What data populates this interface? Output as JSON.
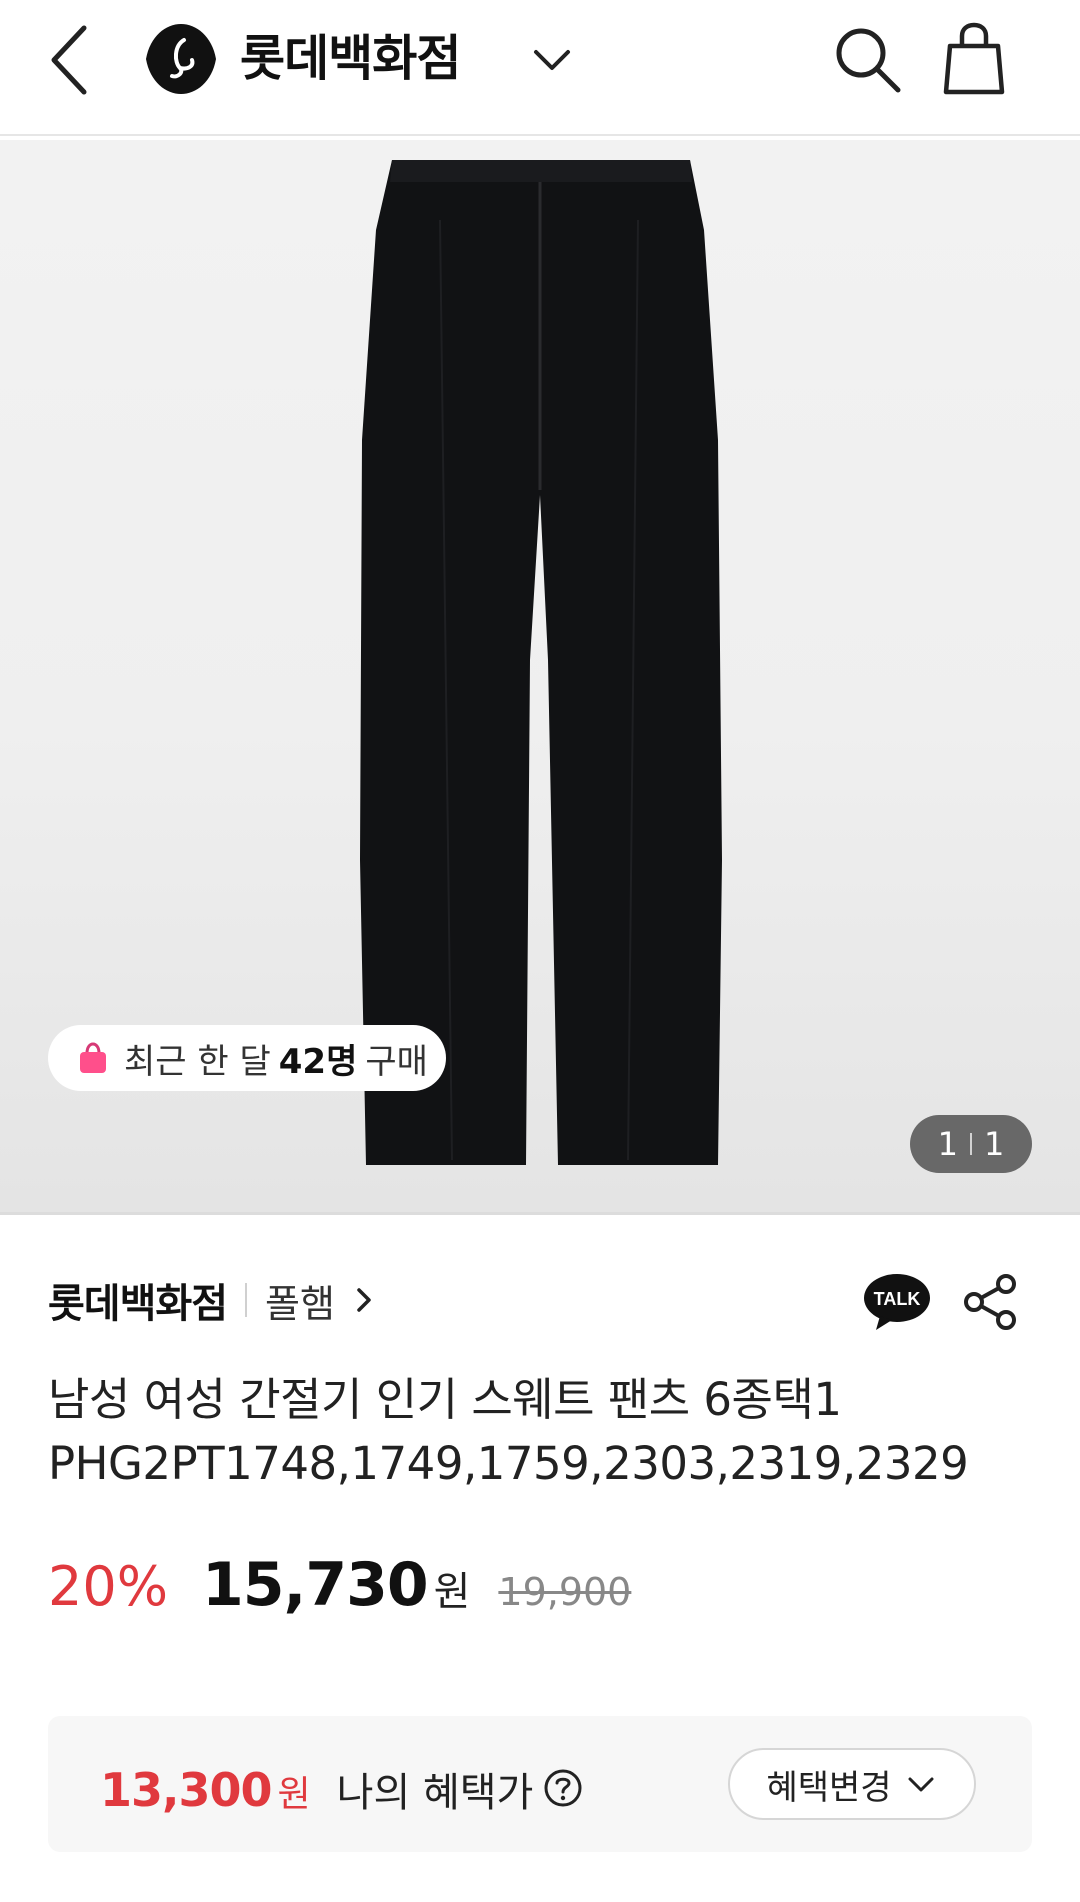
{
  "header": {
    "brand_name": "롯데백화점",
    "icons": [
      "back-arrow-icon",
      "lotte-logo-icon",
      "chevron-down-icon",
      "search-icon",
      "shopping-bag-icon"
    ]
  },
  "gallery": {
    "recent_prefix": "최근 한 달",
    "recent_count": "42명",
    "recent_suffix": "구매",
    "page_current": "1",
    "page_total": "1"
  },
  "product": {
    "store_name": "롯데백화점",
    "brand_name": "폴햄",
    "title_line1": "남성 여성 간절기 인기 스웨트 팬츠 6종택1",
    "title_line2": "PHG2PT1748,1749,1759,2303,2319,2329",
    "talk_label": "TALK"
  },
  "price": {
    "discount": "20%",
    "sale_price": "15,730",
    "won": "원",
    "original_price": "19,900"
  },
  "benefit": {
    "amount": "13,300",
    "won": "원",
    "label": "나의 혜택가",
    "change_button": "혜택변경"
  },
  "colors": {
    "accent_red": "#e0393e",
    "text_dark": "#111111",
    "badge_pink": "#ff4f8b"
  }
}
